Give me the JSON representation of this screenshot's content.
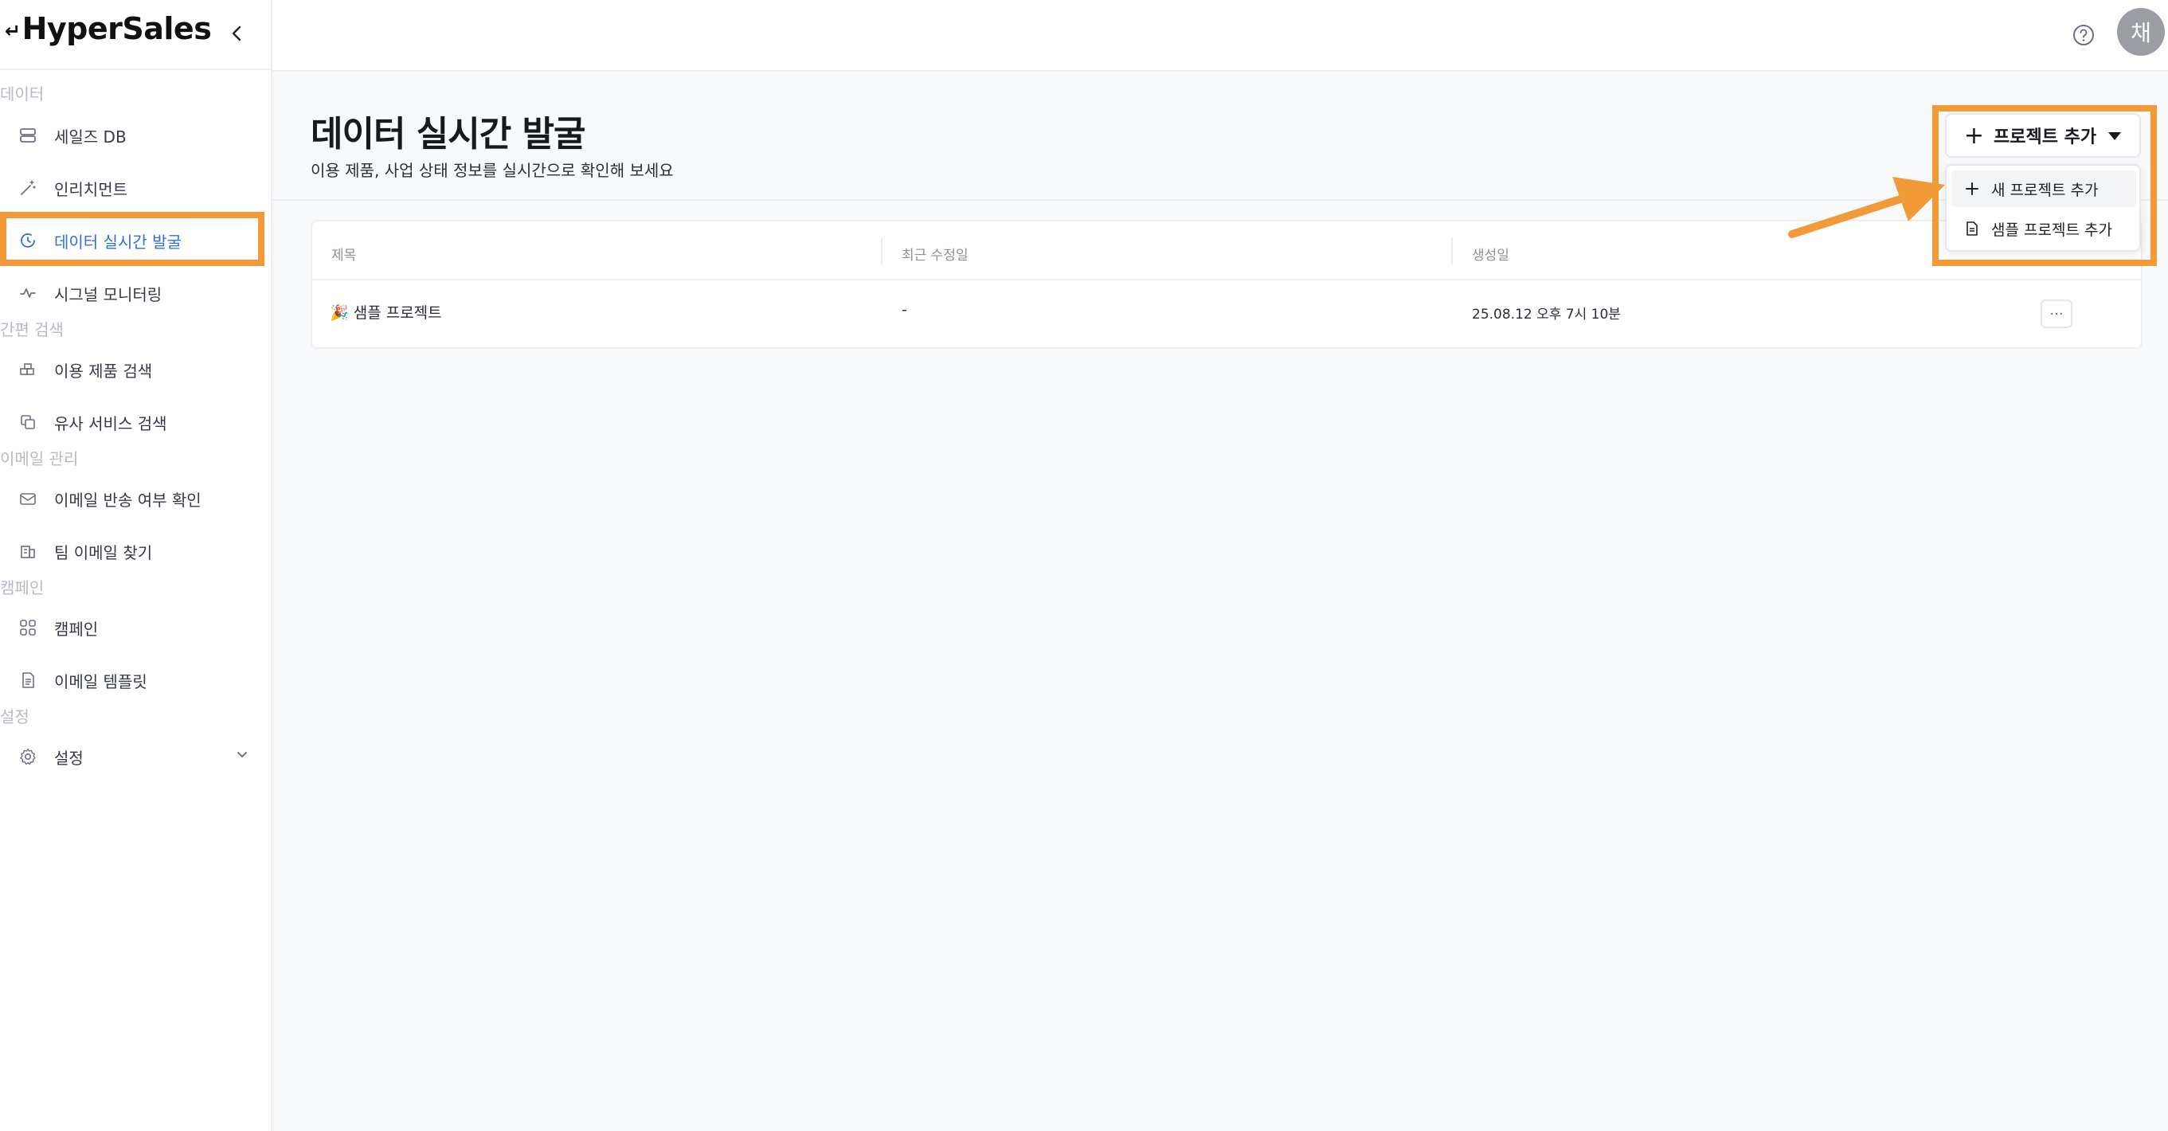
{
  "app": {
    "logo": "HyperSales"
  },
  "sidebar": {
    "sections": [
      {
        "label": "데이터"
      },
      {
        "label": "간편 검색"
      },
      {
        "label": "이메일 관리"
      },
      {
        "label": "캠페인"
      },
      {
        "label": "설정"
      }
    ],
    "items": [
      {
        "label": "세일즈 DB",
        "icon": "database-icon"
      },
      {
        "label": "인리치먼트",
        "icon": "magic-wand-icon"
      },
      {
        "label": "데이터 실시간 발굴",
        "icon": "clock-refresh-icon",
        "active": true
      },
      {
        "label": "시그널 모니터링",
        "icon": "pulse-icon"
      },
      {
        "label": "이용 제품 검색",
        "icon": "blocks-icon"
      },
      {
        "label": "유사 서비스 검색",
        "icon": "copy-search-icon"
      },
      {
        "label": "이메일 반송 여부 확인",
        "icon": "mail-check-icon"
      },
      {
        "label": "팀 이메일 찾기",
        "icon": "building-icon"
      },
      {
        "label": "캠페인",
        "icon": "grid-icon"
      },
      {
        "label": "이메일 템플릿",
        "icon": "document-icon"
      },
      {
        "label": "설정",
        "icon": "gear-icon"
      }
    ]
  },
  "header": {
    "avatar_initial": "채"
  },
  "main": {
    "title": "데이터 실시간 발굴",
    "subtitle": "이용 제품, 사업 상태 정보를 실시간으로 확인해 보세요",
    "add_button": "프로젝트 추가",
    "dropdown": [
      {
        "label": "새 프로젝트 추가",
        "icon": "plus-icon"
      },
      {
        "label": "샘플 프로젝트 추가",
        "icon": "sample-doc-icon"
      }
    ],
    "table": {
      "columns": [
        "제목",
        "최근 수정일",
        "생성일"
      ],
      "rows": [
        {
          "emoji": "🎉",
          "title": "샘플 프로젝트",
          "modified": "-",
          "created": "25.08.12 오후 7시 10분"
        }
      ]
    }
  },
  "colors": {
    "accent": "#2f6fde",
    "highlight": "#f29a38"
  }
}
